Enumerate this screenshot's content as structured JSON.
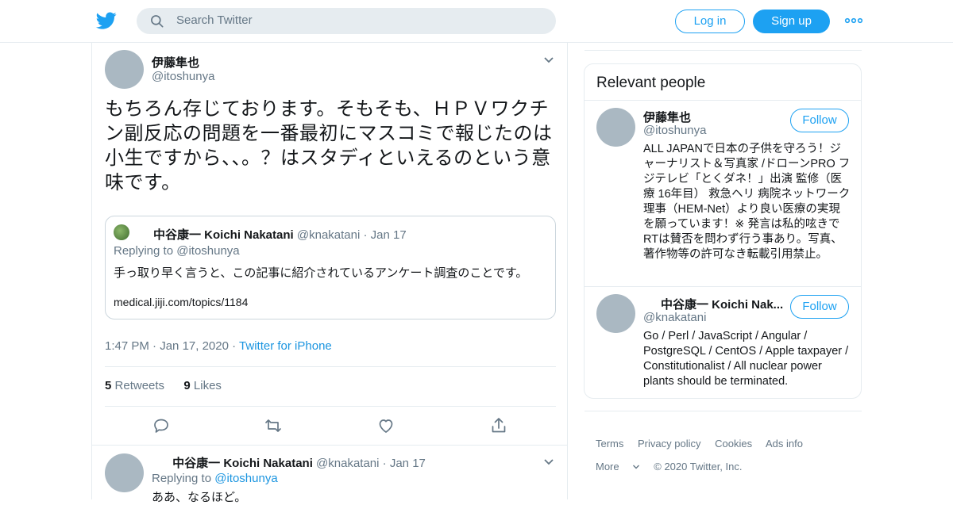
{
  "nav": {
    "search_placeholder": "Search Twitter",
    "login": "Log in",
    "signup": "Sign up"
  },
  "tweet": {
    "name": "伊藤隼也",
    "handle": "@itoshunya",
    "text": "もちろん存じております。そもそも、ＨＰＶワクチン副反応の問題を一番最初にマスコミで報じたのは小生ですから、、。？はスタディといえるのという意味です。",
    "quote": {
      "name": "中谷康一 Koichi Nakatani",
      "handle": "@knakatani",
      "date": "Jan 17",
      "replying": "Replying to @itoshunya",
      "text": "手っ取り早く言うと、この記事に紹介されているアンケート調査のことです。",
      "link": "medical.jiji.com/topics/1184"
    },
    "time": "1:47 PM",
    "date": "Jan 17, 2020",
    "source": "Twitter for iPhone",
    "retweets_count": "5",
    "retweets_label": "Retweets",
    "likes_count": "9",
    "likes_label": "Likes"
  },
  "reply": {
    "name": "中谷康一 Koichi Nakatani",
    "handle": "@knakatani",
    "date": "Jan 17",
    "replying_prefix": "Replying to",
    "replying_handle": "@itoshunya",
    "text": "ああ、なるほど。"
  },
  "relevant": {
    "title": "Relevant people",
    "people": [
      {
        "name": "伊藤隼也",
        "handle": "@itoshunya",
        "follow": "Follow",
        "bio": "ALL JAPANで日本の子供を守ろう！ジャーナリスト＆写真家 /ドローンPRO フジテレビ「とくダネ！」出演 監修（医療 16年目） 救急ヘリ 病院ネットワーク理事（HEM-Net）より良い医療の実現を願っています！※ 発言は私的呟きでRTは賛否を問わず行う事あり。写真、著作物等の許可なき転載引用禁止。"
      },
      {
        "name": "中谷康一 Koichi Nak...",
        "handle": "@knakatani",
        "follow": "Follow",
        "bio": "Go / Perl / JavaScript / Angular / PostgreSQL / CentOS / Apple taxpayer / Constitutionalist / All nuclear power plants should be terminated."
      }
    ]
  },
  "footer": {
    "terms": "Terms",
    "privacy": "Privacy policy",
    "cookies": "Cookies",
    "ads": "Ads info",
    "more": "More",
    "copyright": "© 2020 Twitter, Inc."
  },
  "colors": {
    "accent": "#1da1f2",
    "link": "#1b95e0",
    "muted": "#657786",
    "border": "#e6ecf0"
  }
}
